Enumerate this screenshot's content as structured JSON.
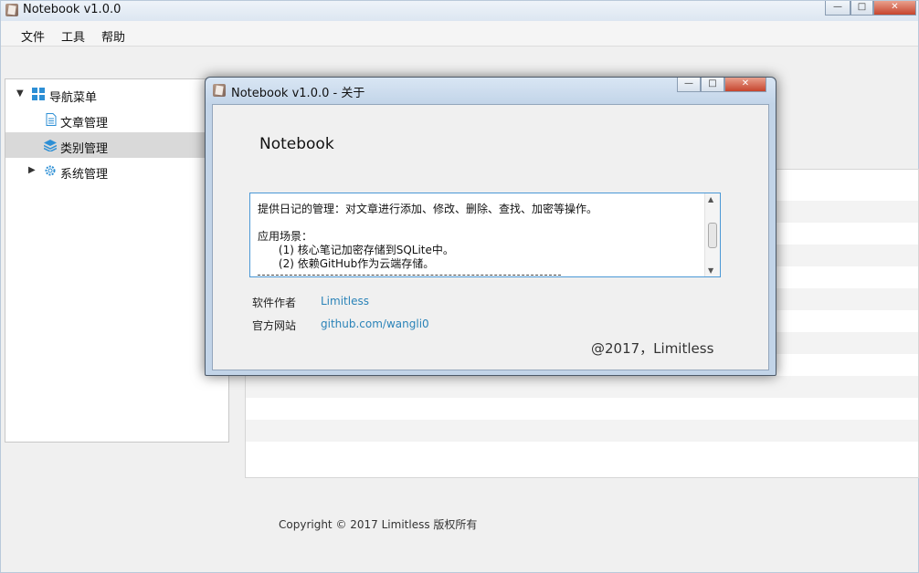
{
  "main_window": {
    "title": "Notebook v1.0.0",
    "controls": {
      "minimize": "—",
      "maximize": "□",
      "close": "✕"
    }
  },
  "menu": [
    "文件",
    "工具",
    "帮助"
  ],
  "nav_tree": {
    "root": {
      "label": "导航菜单",
      "icon": "grid-icon",
      "expanded": true
    },
    "items": [
      {
        "label": "文章管理",
        "icon": "document-icon",
        "selected": false
      },
      {
        "label": "类别管理",
        "icon": "layers-icon",
        "selected": true
      },
      {
        "label": "系统管理",
        "icon": "gear-icon",
        "selected": false,
        "collapsed": true
      }
    ]
  },
  "footer": {
    "copyright": "Copyright © 2017 Limitless 版权所有"
  },
  "about_dialog": {
    "title": "Notebook v1.0.0 - 关于",
    "heading": "Notebook",
    "description": {
      "lines": [
        "提供日记的管理：对文章进行添加、修改、删除、查找、加密等操作。",
        "",
        "应用场景：",
        "      (1) 核心笔记加密存储到SQLite中。",
        "      (2) 依赖GitHub作为云端存储。"
      ]
    },
    "author_label": "软件作者",
    "author_value": "Limitless",
    "website_label": "官方网站",
    "website_value": "github.com/wangli0",
    "signature": "@2017，Limitless"
  },
  "colors": {
    "accent_link": "#2a83b8",
    "selected_row": "#d9d9d9",
    "focus_border": "#4a98d6"
  }
}
